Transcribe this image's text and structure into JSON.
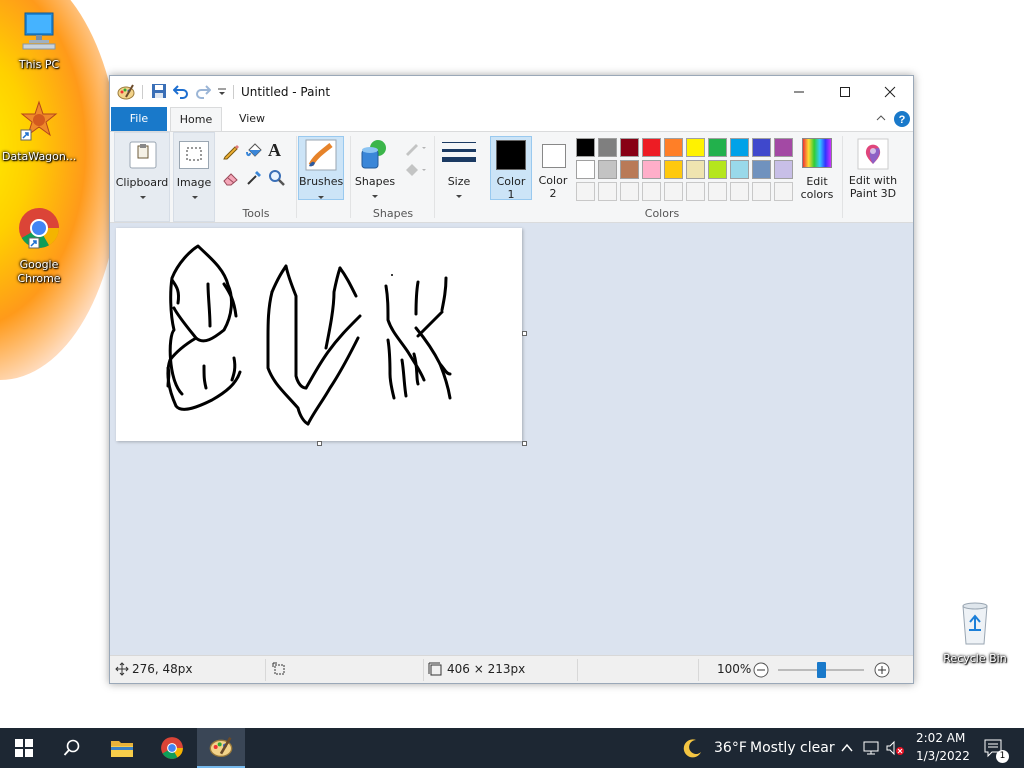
{
  "desktop": {
    "icons": [
      {
        "label": "This PC",
        "icon": "computer-icon"
      },
      {
        "label": "DataWagon...",
        "icon": "shortcut-icon"
      },
      {
        "label": "Google Chrome",
        "icon": "chrome-icon"
      },
      {
        "label": "Recycle Bin",
        "icon": "recycle-bin-icon"
      }
    ]
  },
  "window": {
    "title": "Untitled - Paint",
    "tabs": {
      "file": "File",
      "home": "Home",
      "view": "View"
    },
    "ribbon": {
      "clipboard": "Clipboard",
      "image": "Image",
      "tools_group": "Tools",
      "brushes": "Brushes",
      "shapes": "Shapes",
      "shapes_group": "Shapes",
      "size": "Size",
      "color1": "Color 1",
      "color1_l1": "Color",
      "color1_l2": "1",
      "color2_l1": "Color",
      "color2_l2": "2",
      "colors_group": "Colors",
      "edit_colors_l1": "Edit",
      "edit_colors_l2": "colors",
      "paint3d_l1": "Edit with",
      "paint3d_l2": "Paint 3D"
    },
    "palette": {
      "row1": [
        "#000000",
        "#7f7f7f",
        "#880015",
        "#ed1c24",
        "#ff7f27",
        "#fff200",
        "#22b14c",
        "#00a2e8",
        "#3f48cc",
        "#a349a4"
      ],
      "row2": [
        "#ffffff",
        "#c3c3c3",
        "#b97a57",
        "#ffaec9",
        "#ffc90e",
        "#efe4b0",
        "#b5e61d",
        "#99d9ea",
        "#7092be",
        "#c8bfe7"
      ],
      "row3_empty": 10
    },
    "status": {
      "cursor_pos": "276, 48px",
      "canvas_size": "406 × 213px",
      "zoom": "100%",
      "zoom_fraction": 0.5
    }
  },
  "taskbar": {
    "weather_temp": "36°F",
    "weather_desc": "Mostly clear",
    "time": "2:02 AM",
    "date": "1/3/2022",
    "notification_count": "1"
  },
  "colors": {
    "accent": "#0078d7",
    "taskbar": "#1d2733",
    "canvas_bg": "#dbe3ef"
  }
}
